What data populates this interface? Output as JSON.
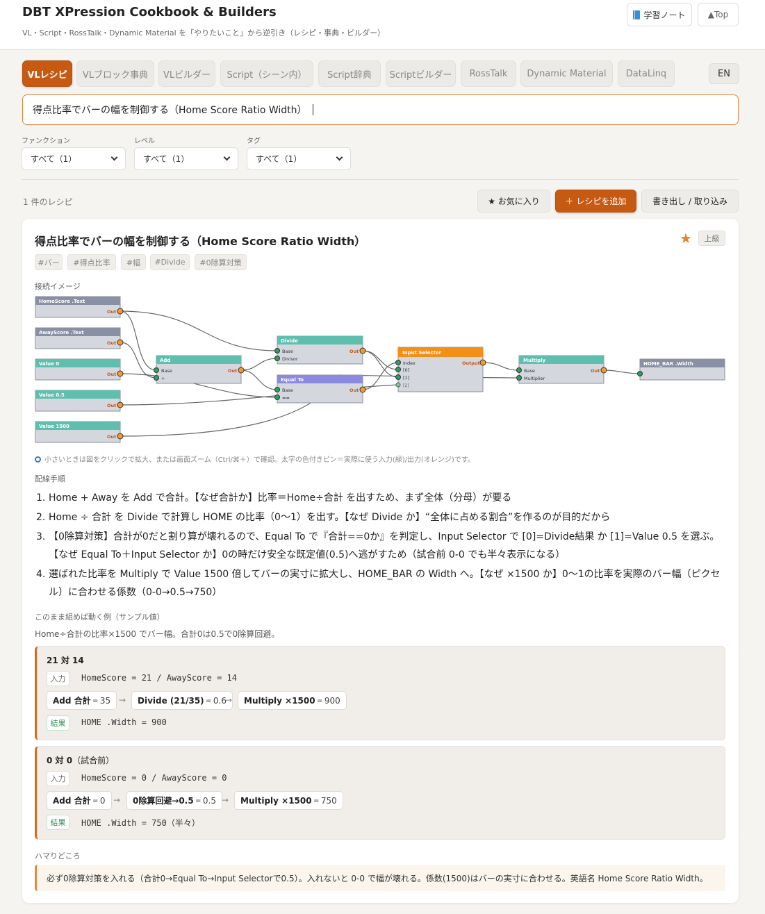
{
  "header": {
    "title": "DBT XPression Cookbook & Builders",
    "subtitle": "VL・Script・RossTalk・Dynamic Material を「やりたいこと」から逆引き（レシピ・事典・ビルダー）",
    "notes_label": "学習ノート",
    "top_label": "▲Top"
  },
  "tabs": [
    "VLレシピ",
    "VLブロック事典",
    "VLビルダー",
    "Script（シーン内）",
    "Script辞典",
    "Scriptビルダー",
    "RossTalk",
    "Dynamic Material",
    "DataLinq"
  ],
  "lang_label": "EN",
  "search": {
    "value": "得点比率でバーの幅を制御する（Home Score Ratio Width）"
  },
  "filters": [
    {
      "label": "ファンクション",
      "value": "すべて（1）"
    },
    {
      "label": "レベル",
      "value": "すべて（1）"
    },
    {
      "label": "タグ",
      "value": "すべて（1）"
    }
  ],
  "toolbar": {
    "count": "1 件のレシピ",
    "favorites_label": "★ お気に入り",
    "add_label": "＋ レシピを追加",
    "export_label": "書き出し / 取り込み"
  },
  "recipe": {
    "title": "得点比率でバーの幅を制御する（Home Score Ratio Width）",
    "star": "★",
    "level": "上級",
    "tags": [
      "#バー",
      "#得点比率",
      "#幅",
      "#Divide",
      "#0除算対策"
    ],
    "diagram_label": "接続イメージ",
    "diagram": {
      "source_nodes": [
        {
          "title": "HomeScore .Text",
          "port": "Out"
        },
        {
          "title": "AwayScore .Text",
          "port": "Out"
        },
        {
          "title": "Value 0",
          "port": "Out"
        },
        {
          "title": "Value 0.5",
          "port": "Out"
        },
        {
          "title": "Value 1500",
          "port": "Out"
        }
      ],
      "add": {
        "title": "Add",
        "inputs": [
          "Base",
          "+"
        ],
        "output": "Out"
      },
      "divide": {
        "title": "Divide",
        "inputs": [
          "Base",
          "Divisor"
        ],
        "output": "Out"
      },
      "equal": {
        "title": "Equal To",
        "inputs": [
          "Base",
          "=="
        ],
        "output": "Out"
      },
      "selector": {
        "title": "Input Selector",
        "inputs": [
          "Index",
          "[0]",
          "[1]",
          "[2]"
        ],
        "output": "Output"
      },
      "multiply": {
        "title": "Multiply",
        "inputs": [
          "Base",
          "Multiplier"
        ],
        "output": "Out"
      },
      "target": {
        "title": "HOME_BAR .Width"
      }
    },
    "hint": "小さいときは図をクリックで拡大、または画面ズーム（Ctrl/⌘＋）で確認。太字の色付きピン＝実際に使う入力(緑)/出力(オレンジ)です。",
    "steps_label": "配線手順",
    "steps": [
      "Home + Away を Add で合計。【なぜ合計か】比率＝Home÷合計 を出すため、まず全体（分母）が要る",
      "Home ÷ 合計 を Divide で計算し HOME の比率（0〜1）を出す。【なぜ Divide か】“全体に占める割合”を作るのが目的だから",
      "【0除算対策】合計が0だと割り算が壊れるので、Equal To で『合計==0か』を判定し、Input Selector で [0]=Divide結果 か [1]=Value 0.5 を選ぶ。【なぜ Equal To＋Input Selector か】0の時だけ安全な既定値(0.5)へ逃がすため（試合前 0-0 でも半々表示になる）",
      "選ばれた比率を Multiply で Value 1500 倍してバーの実寸に拡大し、HOME_BAR の Width へ。【なぜ ×1500 か】0〜1の比率を実際のバー幅（ピクセル）に合わせる係数（0-0→0.5→750）"
    ],
    "example_label": "このまま組めば動く例（サンプル値）",
    "example_desc": "Home÷合計の比率×1500 でバー幅。合計0は0.5で0除算回避。",
    "examples": [
      {
        "title": "21 対 14",
        "title_suffix": "",
        "in_badge": "入力",
        "input": "HomeScore = 21 / AwayScore = 14",
        "chain": [
          {
            "label": "Add 合計",
            "value": "35"
          },
          {
            "label": "Divide (21/35)",
            "value": "0.6"
          },
          {
            "label": "Multiply ×1500",
            "value": "900"
          }
        ],
        "out_badge": "結果",
        "output": "HOME .Width = 900"
      },
      {
        "title": "0 対 0",
        "title_suffix": "（試合前）",
        "in_badge": "入力",
        "input": "HomeScore = 0 / AwayScore = 0",
        "chain": [
          {
            "label": "Add 合計",
            "value": "0"
          },
          {
            "label": "0除算回避→0.5",
            "value": "0.5"
          },
          {
            "label": "Multiply ×1500",
            "value": "750"
          }
        ],
        "out_badge": "結果",
        "output": "HOME .Width = 750（半々）"
      }
    ],
    "pitfall_label": "ハマりどころ",
    "pitfall": "必ず0除算対策を入れる（合計0→Equal To→Input Selectorで0.5）。入れないと 0-0 で幅が壊れる。係数(1500)はバーの実寸に合わせる。英語名 Home Score Ratio Width。"
  },
  "colors": {
    "accent": "#c65a13",
    "node_source": "#8a90a3",
    "node_value": "#5fbfae",
    "node_equal": "#8b89e0",
    "node_selector": "#f28f16",
    "pin_out": "#f39a2b",
    "pin_in": "#2f9e5e"
  }
}
